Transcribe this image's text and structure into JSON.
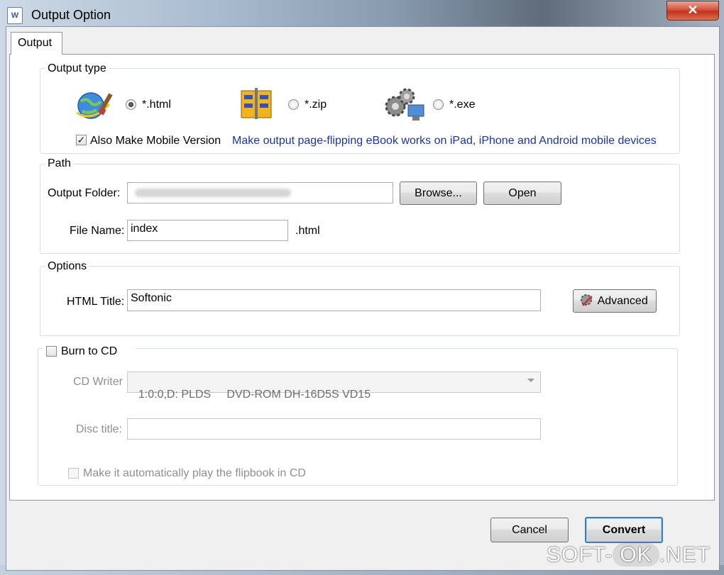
{
  "window": {
    "title": "Output Option",
    "close": "✕",
    "icon_letter": "W"
  },
  "tabs": [
    {
      "label": "Output"
    }
  ],
  "output_type": {
    "legend": "Output type",
    "options": [
      {
        "label": "*.html",
        "selected": true,
        "icon": "globe-brush-icon"
      },
      {
        "label": "*.zip",
        "selected": false,
        "icon": "zip-archive-icon"
      },
      {
        "label": "*.exe",
        "selected": false,
        "icon": "gears-computer-icon"
      }
    ],
    "mobile": {
      "label": "Also Make Mobile Version",
      "checked": true,
      "check": "✓"
    },
    "mobile_link": "Make output page-flipping eBook works on iPad, iPhone and Android mobile devices"
  },
  "path": {
    "legend": "Path",
    "output_folder_label": "Output Folder:",
    "output_folder_value": "",
    "browse": "Browse...",
    "open": "Open",
    "file_name_label": "File Name:",
    "file_name_value": "index",
    "extension": ".html"
  },
  "options": {
    "legend": "Options",
    "html_title_label": "HTML Title:",
    "html_title_value": "Softonic",
    "advanced": "Advanced"
  },
  "burn": {
    "label": "Burn to CD",
    "checked": false,
    "cd_writer_label": "CD Writer",
    "cd_writer_value": "1:0:0,D: PLDS     DVD-ROM DH-16D5S VD15",
    "disc_title_label": "Disc title:",
    "disc_title_value": "",
    "autoplay_label": "Make it automatically play the flipbook in CD"
  },
  "buttons": {
    "cancel": "Cancel",
    "convert": "Convert"
  },
  "watermark": {
    "left": "SOFT-",
    "middle": "OK",
    "right": ".NET"
  },
  "colors": {
    "link": "#1a34a8",
    "default_border": "#3c7fb1",
    "disabled": "#8f8f8f"
  }
}
